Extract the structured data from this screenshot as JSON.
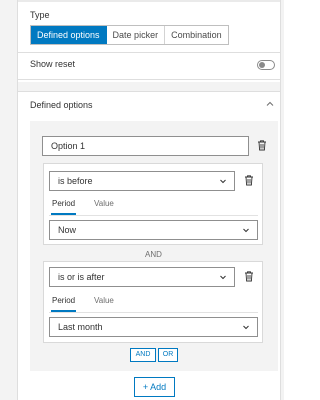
{
  "type_section": {
    "label": "Type",
    "segments": [
      "Defined options",
      "Date picker",
      "Combination"
    ],
    "active_segment": "Defined options"
  },
  "show_reset": {
    "label": "Show reset",
    "enabled": false
  },
  "defined_options": {
    "title": "Defined options",
    "option_name": "Option 1",
    "conditions": [
      {
        "operator": "is before",
        "tabs": [
          "Period",
          "Value"
        ],
        "active_tab": "Period",
        "period_value": "Now"
      },
      {
        "operator": "is or is after",
        "tabs": [
          "Period",
          "Value"
        ],
        "active_tab": "Period",
        "period_value": "Last month"
      }
    ],
    "join_label": "AND",
    "and_button": "AND",
    "or_button": "OR"
  },
  "add_button": "+ Add",
  "icons": {
    "trash": "trash-icon",
    "caret": "chevron-down-icon",
    "collapse": "chevron-up-icon"
  },
  "colors": {
    "accent": "#0079c1",
    "panel": "#f3f3f3"
  }
}
